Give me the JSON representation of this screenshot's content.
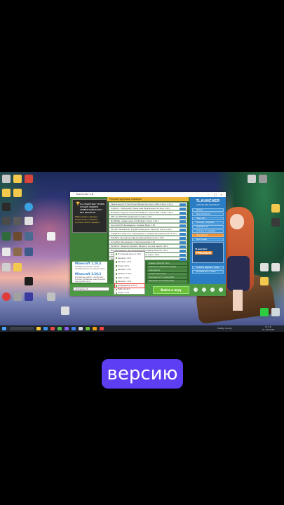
{
  "launcher": {
    "title": "TLauncher 2.8",
    "ad": {
      "headline": "НА ЛИЦЕНЗИИ ТЕПЕРЬ ЛУЧШЕ! ВЫБЕРИ СЕРВЕР МАЙНКРАФТ БЕЗ ВЫЛЕТОВ",
      "sub": "Майнкрафт сервера Подключись! Новые Лучшие 2024 Сервера"
    },
    "servers_header": "Рекомендуемые сервера",
    "servers": [
      "Развлечения [Тотем] Разнообразие Survival, Crafts и Skins 1.20.4",
      "TopWorld - Майнкрафт Приватный Развлечения Survival 1.20.1",
      "MineWorld: Крутые Аномалии SkyBlock, Genius RPG и Skins 1.20.4",
      "TNT / XX PVP TNT Deathmatch Creative 1.20",
      "MiniBattle: сервер мини-игр Bedwars, Prison 1.20.1",
      "SurvivalCraft: Выживание с модами Magic 1.20",
      "EzCraft: Выживание, SkyWars Ванильное, Креатив, Arena 1.20.4",
      "CrazyBuild: Новости и информация о сервере MC Развлечения 1.20.1",
      "HoloMine: Выживание Дружелюбный Творчество 1.20.2",
      "LuckyMine: Выживание с приключениями 1.20",
      "SkyWorld: Незерпаз SkyWars, Bedwars, Survival Арена 1.20.4",
      "Мир Выживания: Дружелюбный PVP Сервер Креатив 1.20.4",
      "ProServer: Выживание Скайблок Мини-игры 1.20.4",
      "Heaven: Выживание Ролевые 1.20.1"
    ],
    "sidebar": {
      "logo": "TLAUNCHER",
      "subtitle": "ЛАУНЧЕР ДЛЯ МАЙНКРАФТ",
      "buttons": [
        "Форум",
        "Наш Телеграм",
        "Наш сайт",
        "Помощь / Справка",
        "Разработчик",
        "Скачать TL Сервера",
        "Наш Discord",
        "Мои Скины"
      ],
      "premium_top": "TLauncher",
      "premium_bottom": "PREMIUM",
      "bottom_buttons": [
        "Скачать аддоны / моды",
        "Оставайтесь с нами"
      ]
    },
    "news": [
      {
        "title": "Minecraft 1.20.4",
        "text": "Исправления игровых ошибок: исправлен вылет при загрузке мира"
      },
      {
        "title": "Minecraft 1.20.3",
        "text": "Исправлены ошибки с нерабочими блоками. Добавлены новые функции для разработчиков"
      }
    ],
    "versions": [
      "Последний релиз 1.20.4",
      "Release 1.20.3",
      "Release 1.20.2",
      "Forge 1.20.1",
      "Release 1.20.1",
      "OptiFine 1.20.1",
      "Fabric 1.20.1",
      "Release 1.19.4",
      "ForgeOptiFine 1.20.1",
      "Fabric 1.19.4",
      "Forge 1.19.4"
    ],
    "selected_version": "ForgeOptiFine 1.20.1",
    "mid_right": [
      "Сервера / Minecraft 1.20.4",
      "Запустить на выбранном сервере",
      "Новые версии",
      "Скачать пакет 1.20.4",
      "Обновление от 17 января 2024",
      "Обновление от 29 января 2024"
    ],
    "account": "nickname_24",
    "play_label": "Войти в игру"
  },
  "taskbar": {
    "weather": "Mostly cloudy",
    "time": "11:16",
    "date": "21.03.2024"
  },
  "caption": "версию",
  "colors": {
    "caption_bg": "#5d3ef2",
    "sidebar": "#2a7cc4",
    "launcher_green": "#3f7f39",
    "play": "#6cbf3b"
  }
}
